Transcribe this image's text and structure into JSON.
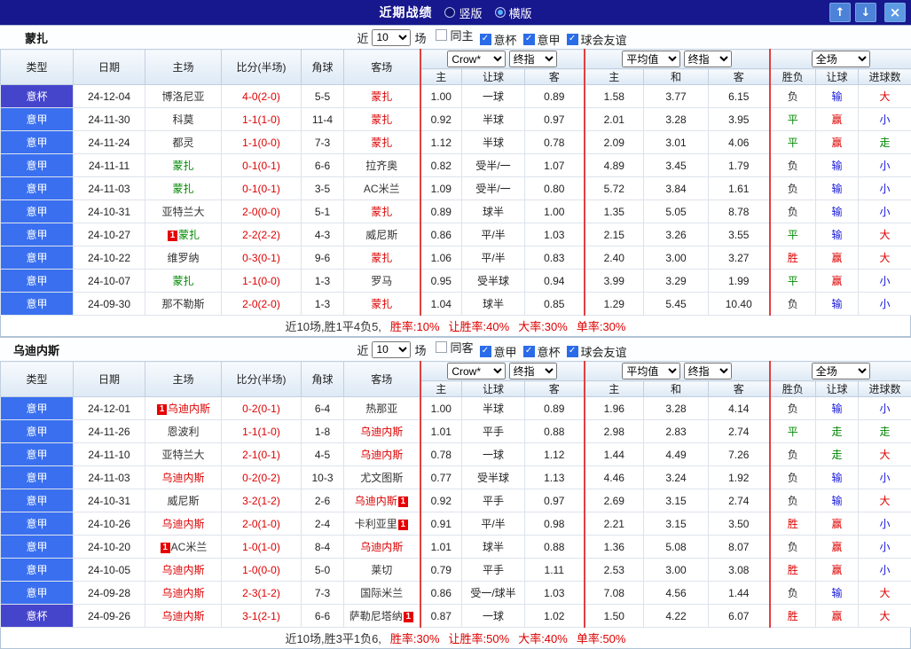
{
  "palette": {
    "red": "#dd0000",
    "green": "#008800",
    "blue": "#1717dd",
    "dark": "#333333",
    "titlebar_bg": "#17178e",
    "accent_blue": "#2a6ce8"
  },
  "league_colors": {
    "意甲": "#3a70f0",
    "意杯": "#4545cc"
  },
  "result_colors": {
    "胜": "red",
    "平": "green",
    "负": "dark",
    "赢": "red",
    "输": "blue",
    "走": "green",
    "大": "red",
    "小": "blue"
  },
  "titlebar": {
    "title": "近期战绩",
    "radios": [
      {
        "label": "竖版",
        "selected": false
      },
      {
        "label": "横版",
        "selected": true
      }
    ],
    "buttons": {
      "up": "↑",
      "down": "↓",
      "close": "×"
    }
  },
  "controls": {
    "near": "近",
    "unit": "场",
    "count": "10",
    "asian_provider": "Crow*",
    "asian_type": "终指",
    "euro_provider": "平均值",
    "euro_type": "终指",
    "scope": "全场"
  },
  "table_header": {
    "left": [
      "类型",
      "日期",
      "主场",
      "比分(半场)",
      "角球",
      "客场"
    ],
    "asian": [
      "主",
      "让球",
      "客"
    ],
    "euro": [
      "主",
      "和",
      "客"
    ],
    "right": [
      "胜负",
      "让球",
      "进球数"
    ]
  },
  "sections": [
    {
      "team": "蒙扎",
      "filters": [
        {
          "label": "同主",
          "checked": false
        },
        {
          "label": "意杯",
          "checked": true
        },
        {
          "label": "意甲",
          "checked": true
        },
        {
          "label": "球会友谊",
          "checked": true
        }
      ],
      "rows": [
        {
          "league": "意杯",
          "date": "24-12-04",
          "home": {
            "name": "博洛尼亚",
            "color": "dark"
          },
          "score": "4-0(2-0)",
          "corner": "5-5",
          "away": {
            "name": "蒙扎",
            "color": "red"
          },
          "asian": [
            "1.00",
            "一球",
            "0.89"
          ],
          "euro": [
            "1.58",
            "3.77",
            "6.15"
          ],
          "results": [
            "负",
            "输",
            "大"
          ]
        },
        {
          "league": "意甲",
          "date": "24-11-30",
          "home": {
            "name": "科莫",
            "color": "dark"
          },
          "score": "1-1(1-0)",
          "corner": "11-4",
          "away": {
            "name": "蒙扎",
            "color": "red"
          },
          "asian": [
            "0.92",
            "半球",
            "0.97"
          ],
          "euro": [
            "2.01",
            "3.28",
            "3.95"
          ],
          "results": [
            "平",
            "赢",
            "小"
          ]
        },
        {
          "league": "意甲",
          "date": "24-11-24",
          "home": {
            "name": "都灵",
            "color": "dark"
          },
          "score": "1-1(0-0)",
          "corner": "7-3",
          "away": {
            "name": "蒙扎",
            "color": "red"
          },
          "asian": [
            "1.12",
            "半球",
            "0.78"
          ],
          "euro": [
            "2.09",
            "3.01",
            "4.06"
          ],
          "results": [
            "平",
            "赢",
            "走"
          ]
        },
        {
          "league": "意甲",
          "date": "24-11-11",
          "home": {
            "name": "蒙扎",
            "color": "green"
          },
          "score": "0-1(0-1)",
          "corner": "6-6",
          "away": {
            "name": "拉齐奥",
            "color": "dark"
          },
          "asian": [
            "0.82",
            "受半/一",
            "1.07"
          ],
          "euro": [
            "4.89",
            "3.45",
            "1.79"
          ],
          "results": [
            "负",
            "输",
            "小"
          ]
        },
        {
          "league": "意甲",
          "date": "24-11-03",
          "home": {
            "name": "蒙扎",
            "color": "green"
          },
          "score": "0-1(0-1)",
          "corner": "3-5",
          "away": {
            "name": "AC米兰",
            "color": "dark"
          },
          "asian": [
            "1.09",
            "受半/一",
            "0.80"
          ],
          "euro": [
            "5.72",
            "3.84",
            "1.61"
          ],
          "results": [
            "负",
            "输",
            "小"
          ]
        },
        {
          "league": "意甲",
          "date": "24-10-31",
          "home": {
            "name": "亚特兰大",
            "color": "dark"
          },
          "score": "2-0(0-0)",
          "corner": "5-1",
          "away": {
            "name": "蒙扎",
            "color": "red"
          },
          "asian": [
            "0.89",
            "球半",
            "1.00"
          ],
          "euro": [
            "1.35",
            "5.05",
            "8.78"
          ],
          "results": [
            "负",
            "输",
            "小"
          ]
        },
        {
          "league": "意甲",
          "date": "24-10-27",
          "home": {
            "name": "蒙扎",
            "color": "green",
            "badge": "1",
            "badge_pos": "before"
          },
          "score": "2-2(2-2)",
          "corner": "4-3",
          "away": {
            "name": "威尼斯",
            "color": "dark"
          },
          "asian": [
            "0.86",
            "平/半",
            "1.03"
          ],
          "euro": [
            "2.15",
            "3.26",
            "3.55"
          ],
          "results": [
            "平",
            "输",
            "大"
          ]
        },
        {
          "league": "意甲",
          "date": "24-10-22",
          "home": {
            "name": "维罗纳",
            "color": "dark"
          },
          "score": "0-3(0-1)",
          "corner": "9-6",
          "away": {
            "name": "蒙扎",
            "color": "red"
          },
          "asian": [
            "1.06",
            "平/半",
            "0.83"
          ],
          "euro": [
            "2.40",
            "3.00",
            "3.27"
          ],
          "results": [
            "胜",
            "赢",
            "大"
          ]
        },
        {
          "league": "意甲",
          "date": "24-10-07",
          "home": {
            "name": "蒙扎",
            "color": "green"
          },
          "score": "1-1(0-0)",
          "corner": "1-3",
          "away": {
            "name": "罗马",
            "color": "dark"
          },
          "asian": [
            "0.95",
            "受半球",
            "0.94"
          ],
          "euro": [
            "3.99",
            "3.29",
            "1.99"
          ],
          "results": [
            "平",
            "赢",
            "小"
          ]
        },
        {
          "league": "意甲",
          "date": "24-09-30",
          "home": {
            "name": "那不勒斯",
            "color": "dark"
          },
          "score": "2-0(2-0)",
          "corner": "1-3",
          "away": {
            "name": "蒙扎",
            "color": "red"
          },
          "asian": [
            "1.04",
            "球半",
            "0.85"
          ],
          "euro": [
            "1.29",
            "5.45",
            "10.40"
          ],
          "results": [
            "负",
            "输",
            "小"
          ]
        }
      ],
      "summary": {
        "prefix": "近10场,胜1平4负5,",
        "stats": [
          "胜率:10%",
          "让胜率:40%",
          "大率:30%",
          "单率:30%"
        ]
      }
    },
    {
      "team": "乌迪内斯",
      "filters": [
        {
          "label": "同客",
          "checked": false
        },
        {
          "label": "意甲",
          "checked": true
        },
        {
          "label": "意杯",
          "checked": true
        },
        {
          "label": "球会友谊",
          "checked": true
        }
      ],
      "rows": [
        {
          "league": "意甲",
          "date": "24-12-01",
          "home": {
            "name": "乌迪内斯",
            "color": "red",
            "badge": "1",
            "badge_pos": "before"
          },
          "score": "0-2(0-1)",
          "corner": "6-4",
          "away": {
            "name": "热那亚",
            "color": "dark"
          },
          "asian": [
            "1.00",
            "半球",
            "0.89"
          ],
          "euro": [
            "1.96",
            "3.28",
            "4.14"
          ],
          "results": [
            "负",
            "输",
            "小"
          ]
        },
        {
          "league": "意甲",
          "date": "24-11-26",
          "home": {
            "name": "恩波利",
            "color": "dark"
          },
          "score": "1-1(1-0)",
          "corner": "1-8",
          "away": {
            "name": "乌迪内斯",
            "color": "red"
          },
          "asian": [
            "1.01",
            "平手",
            "0.88"
          ],
          "euro": [
            "2.98",
            "2.83",
            "2.74"
          ],
          "results": [
            "平",
            "走",
            "走"
          ]
        },
        {
          "league": "意甲",
          "date": "24-11-10",
          "home": {
            "name": "亚特兰大",
            "color": "dark"
          },
          "score": "2-1(0-1)",
          "corner": "4-5",
          "away": {
            "name": "乌迪内斯",
            "color": "red"
          },
          "asian": [
            "0.78",
            "一球",
            "1.12"
          ],
          "euro": [
            "1.44",
            "4.49",
            "7.26"
          ],
          "results": [
            "负",
            "走",
            "大"
          ]
        },
        {
          "league": "意甲",
          "date": "24-11-03",
          "home": {
            "name": "乌迪内斯",
            "color": "red"
          },
          "score": "0-2(0-2)",
          "corner": "10-3",
          "away": {
            "name": "尤文图斯",
            "color": "dark"
          },
          "asian": [
            "0.77",
            "受半球",
            "1.13"
          ],
          "euro": [
            "4.46",
            "3.24",
            "1.92"
          ],
          "results": [
            "负",
            "输",
            "小"
          ]
        },
        {
          "league": "意甲",
          "date": "24-10-31",
          "home": {
            "name": "威尼斯",
            "color": "dark"
          },
          "score": "3-2(1-2)",
          "corner": "2-6",
          "away": {
            "name": "乌迪内斯",
            "color": "red",
            "badge": "1",
            "badge_pos": "after"
          },
          "asian": [
            "0.92",
            "平手",
            "0.97"
          ],
          "euro": [
            "2.69",
            "3.15",
            "2.74"
          ],
          "results": [
            "负",
            "输",
            "大"
          ]
        },
        {
          "league": "意甲",
          "date": "24-10-26",
          "home": {
            "name": "乌迪内斯",
            "color": "red"
          },
          "score": "2-0(1-0)",
          "corner": "2-4",
          "away": {
            "name": "卡利亚里",
            "color": "dark",
            "badge": "1",
            "badge_pos": "after"
          },
          "asian": [
            "0.91",
            "平/半",
            "0.98"
          ],
          "euro": [
            "2.21",
            "3.15",
            "3.50"
          ],
          "results": [
            "胜",
            "赢",
            "小"
          ]
        },
        {
          "league": "意甲",
          "date": "24-10-20",
          "home": {
            "name": "AC米兰",
            "color": "dark",
            "badge": "1",
            "badge_pos": "before"
          },
          "score": "1-0(1-0)",
          "corner": "8-4",
          "away": {
            "name": "乌迪内斯",
            "color": "red"
          },
          "asian": [
            "1.01",
            "球半",
            "0.88"
          ],
          "euro": [
            "1.36",
            "5.08",
            "8.07"
          ],
          "results": [
            "负",
            "赢",
            "小"
          ]
        },
        {
          "league": "意甲",
          "date": "24-10-05",
          "home": {
            "name": "乌迪内斯",
            "color": "red"
          },
          "score": "1-0(0-0)",
          "corner": "5-0",
          "away": {
            "name": "莱切",
            "color": "dark"
          },
          "asian": [
            "0.79",
            "平手",
            "1.11"
          ],
          "euro": [
            "2.53",
            "3.00",
            "3.08"
          ],
          "results": [
            "胜",
            "赢",
            "小"
          ]
        },
        {
          "league": "意甲",
          "date": "24-09-28",
          "home": {
            "name": "乌迪内斯",
            "color": "red"
          },
          "score": "2-3(1-2)",
          "corner": "7-3",
          "away": {
            "name": "国际米兰",
            "color": "dark"
          },
          "asian": [
            "0.86",
            "受一/球半",
            "1.03"
          ],
          "euro": [
            "7.08",
            "4.56",
            "1.44"
          ],
          "results": [
            "负",
            "输",
            "大"
          ]
        },
        {
          "league": "意杯",
          "date": "24-09-26",
          "home": {
            "name": "乌迪内斯",
            "color": "red"
          },
          "score": "3-1(2-1)",
          "corner": "6-6",
          "away": {
            "name": "萨勒尼塔纳",
            "color": "dark",
            "badge": "1",
            "badge_pos": "after"
          },
          "asian": [
            "0.87",
            "一球",
            "1.02"
          ],
          "euro": [
            "1.50",
            "4.22",
            "6.07"
          ],
          "results": [
            "胜",
            "赢",
            "大"
          ]
        }
      ],
      "summary": {
        "prefix": "近10场,胜3平1负6,",
        "stats": [
          "胜率:30%",
          "让胜率:50%",
          "大率:40%",
          "单率:50%"
        ]
      }
    }
  ]
}
